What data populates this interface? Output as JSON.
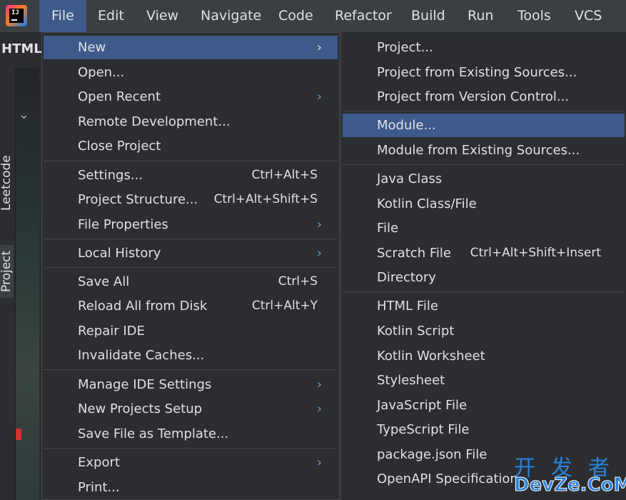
{
  "menubar": {
    "items": [
      {
        "label": "File",
        "mnemonic": "F"
      },
      {
        "label": "Edit",
        "mnemonic": "E"
      },
      {
        "label": "View",
        "mnemonic": "V"
      },
      {
        "label": "Navigate",
        "mnemonic": "N"
      },
      {
        "label": "Code",
        "mnemonic": "C"
      },
      {
        "label": "Refactor",
        "mnemonic": "R"
      },
      {
        "label": "Build",
        "mnemonic": "B"
      },
      {
        "label": "Run",
        "mnemonic": "u"
      },
      {
        "label": "Tools",
        "mnemonic": "T"
      },
      {
        "label": "VCS",
        "mnemonic": "S"
      }
    ]
  },
  "app_logo_text": "IJ",
  "sidebar": {
    "tab_label": "HTML",
    "vertical_tabs": [
      "Leetcode",
      "Project"
    ]
  },
  "file_menu": {
    "items": [
      {
        "label": "New",
        "submenu": true
      },
      {
        "label": "Open..."
      },
      {
        "label": "Open Recent",
        "submenu": true
      },
      {
        "label": "Remote Development..."
      },
      {
        "label": "Close Project"
      },
      {
        "label": "Settings...",
        "shortcut": "Ctrl+Alt+S"
      },
      {
        "label": "Project Structure...",
        "shortcut": "Ctrl+Alt+Shift+S"
      },
      {
        "label": "File Properties",
        "submenu": true
      },
      {
        "label": "Local History",
        "submenu": true
      },
      {
        "label": "Save All",
        "shortcut": "Ctrl+S"
      },
      {
        "label": "Reload All from Disk",
        "shortcut": "Ctrl+Alt+Y"
      },
      {
        "label": "Repair IDE"
      },
      {
        "label": "Invalidate Caches..."
      },
      {
        "label": "Manage IDE Settings",
        "submenu": true
      },
      {
        "label": "New Projects Setup",
        "submenu": true
      },
      {
        "label": "Save File as Template..."
      },
      {
        "label": "Export",
        "submenu": true
      },
      {
        "label": "Print..."
      }
    ]
  },
  "new_menu": {
    "items": [
      {
        "label": "Project..."
      },
      {
        "label": "Project from Existing Sources..."
      },
      {
        "label": "Project from Version Control..."
      },
      {
        "label": "Module..."
      },
      {
        "label": "Module from Existing Sources..."
      },
      {
        "label": "Java Class"
      },
      {
        "label": "Kotlin Class/File"
      },
      {
        "label": "File"
      },
      {
        "label": "Scratch File",
        "shortcut": "Ctrl+Alt+Shift+Insert"
      },
      {
        "label": "Directory"
      },
      {
        "label": "HTML File"
      },
      {
        "label": "Kotlin Script"
      },
      {
        "label": "Kotlin Worksheet"
      },
      {
        "label": "Stylesheet"
      },
      {
        "label": "JavaScript File"
      },
      {
        "label": "TypeScript File"
      },
      {
        "label": "package.json File"
      },
      {
        "label": "OpenAPI Specification"
      }
    ]
  },
  "watermark": {
    "cn": "开发者",
    "en": "DevZe.CoM"
  },
  "colors": {
    "highlight": "#3d5a8a",
    "submenu_arrow": "#5ca1e6",
    "menu_bg": "#2b2d30"
  }
}
